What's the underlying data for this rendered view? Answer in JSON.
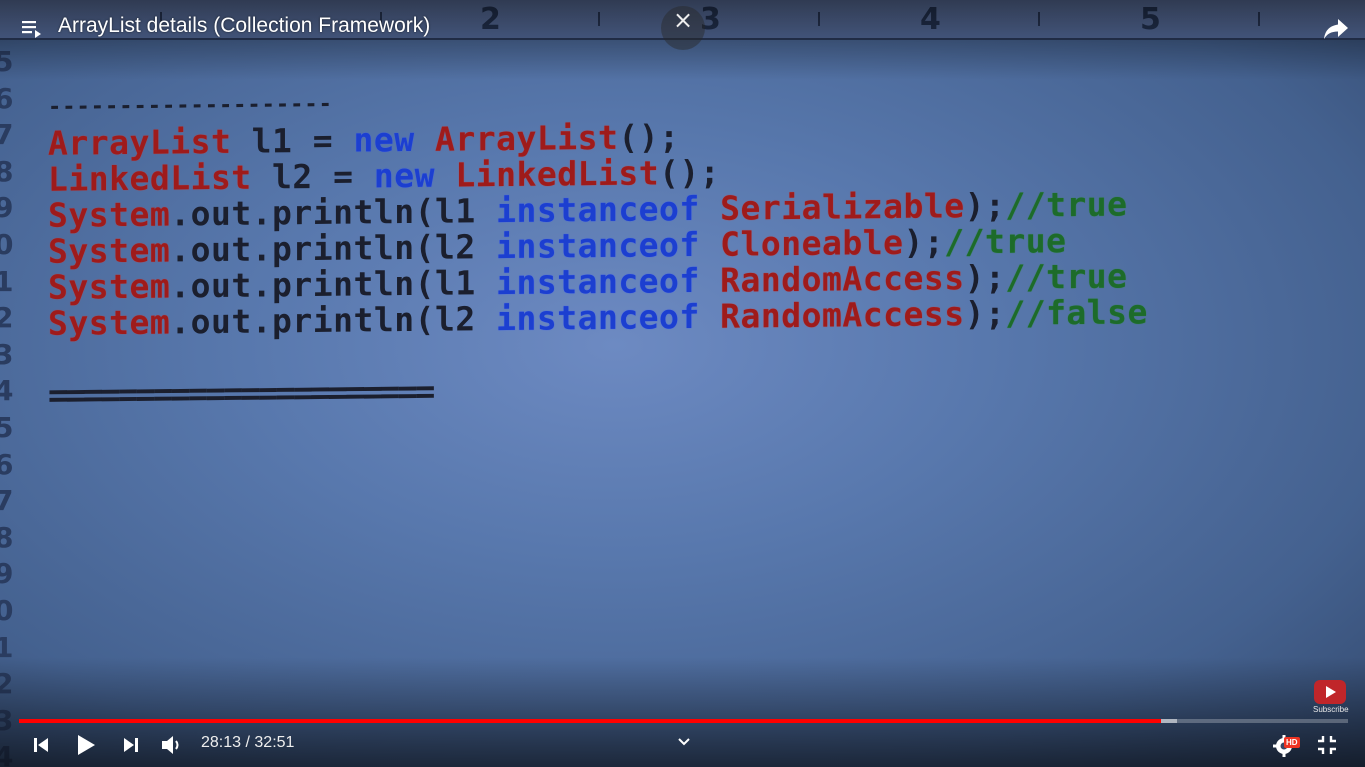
{
  "header": {
    "title": "ArrayList details (Collection Framework)"
  },
  "ruler": {
    "numbers": [
      "2",
      "3",
      "4",
      "5"
    ]
  },
  "line_numbers": [
    "5",
    "6",
    "7",
    "8",
    "9",
    "0",
    "1",
    "2",
    "3",
    "4",
    "5",
    "6",
    "7",
    "8",
    "9",
    "0",
    "1",
    "2",
    "3",
    "4"
  ],
  "code": {
    "dashes": "--------------------",
    "line1": {
      "a": "ArrayList",
      "b": " l1 = ",
      "c": "new",
      "d": " ArrayList",
      "e": "();"
    },
    "line2": {
      "a": "LinkedList",
      "b": " l2 = ",
      "c": "new",
      "d": " LinkedList",
      "e": "();"
    },
    "line3": {
      "a": "System",
      "b": ".out.println(l1 ",
      "c": "instanceof",
      "d": " Serializable",
      "e": ");",
      "f": "//true"
    },
    "line4": {
      "a": "System",
      "b": ".out.println(l2 ",
      "c": "instanceof",
      "d": " Cloneable",
      "e": ");",
      "f": "//true"
    },
    "line5": {
      "a": "System",
      "b": ".out.println(l1 ",
      "c": "instanceof",
      "d": " RandomAccess",
      "e": ");",
      "f": "//true"
    },
    "line6": {
      "a": "System",
      "b": ".out.println(l2 ",
      "c": "instanceof",
      "d": " RandomAccess",
      "e": ");",
      "f": "//false"
    },
    "equals": "======================"
  },
  "player": {
    "current_time": "28:13",
    "separator": " / ",
    "duration": "32:51",
    "played_fraction": 0.859,
    "buffered_fraction": 0.871,
    "subscribe_label": "Subscribe",
    "hd_label": "HD",
    "close_glyph": "×"
  },
  "icons": [
    "playlist-icon",
    "close-icon",
    "share-icon",
    "previous-icon",
    "play-icon",
    "next-icon",
    "volume-icon",
    "chevron-down-icon",
    "settings-icon",
    "exit-fullscreen-icon",
    "subscribe-icon"
  ]
}
